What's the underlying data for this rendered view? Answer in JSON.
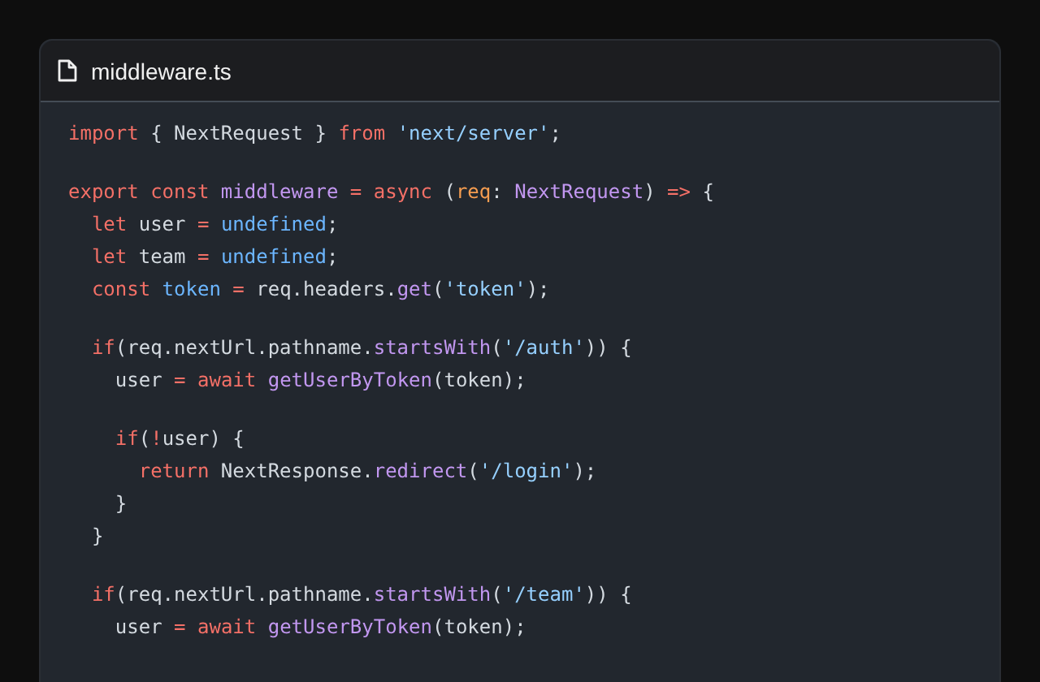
{
  "file_tab": {
    "title": "middleware.ts"
  },
  "code_lines": [
    {
      "kind": "code",
      "tokens": [
        {
          "kind": "keyword",
          "text": "import"
        },
        {
          "kind": "plain",
          "text": " { NextRequest } "
        },
        {
          "kind": "keyword",
          "text": "from"
        },
        {
          "kind": "string",
          "text": " 'next/server'"
        },
        {
          "kind": "plain",
          "text": ";"
        }
      ]
    },
    {
      "kind": "blank"
    },
    {
      "kind": "code",
      "tokens": [
        {
          "kind": "keyword",
          "text": "export const"
        },
        {
          "kind": "function",
          "text": " middleware"
        },
        {
          "kind": "keyword",
          "text": " ="
        },
        {
          "kind": "keyword",
          "text": " async"
        },
        {
          "kind": "plain",
          "text": " ("
        },
        {
          "kind": "param",
          "text": "req"
        },
        {
          "kind": "plain",
          "text": ": "
        },
        {
          "kind": "function",
          "text": "NextRequest"
        },
        {
          "kind": "plain",
          "text": ") "
        },
        {
          "kind": "keyword",
          "text": "=>"
        },
        {
          "kind": "plain",
          "text": " {"
        }
      ]
    },
    {
      "kind": "code",
      "tokens": [
        {
          "kind": "keyword",
          "text": "  let"
        },
        {
          "kind": "plain",
          "text": " user "
        },
        {
          "kind": "keyword",
          "text": "="
        },
        {
          "kind": "constant",
          "text": " undefined"
        },
        {
          "kind": "plain",
          "text": ";"
        }
      ]
    },
    {
      "kind": "code",
      "tokens": [
        {
          "kind": "keyword",
          "text": "  let"
        },
        {
          "kind": "plain",
          "text": " team "
        },
        {
          "kind": "keyword",
          "text": "="
        },
        {
          "kind": "constant",
          "text": " undefined"
        },
        {
          "kind": "plain",
          "text": ";"
        }
      ]
    },
    {
      "kind": "code",
      "tokens": [
        {
          "kind": "keyword",
          "text": "  const"
        },
        {
          "kind": "constant",
          "text": " token"
        },
        {
          "kind": "keyword",
          "text": " ="
        },
        {
          "kind": "plain",
          "text": " req.headers."
        },
        {
          "kind": "function",
          "text": "get"
        },
        {
          "kind": "plain",
          "text": "("
        },
        {
          "kind": "string",
          "text": "'token'"
        },
        {
          "kind": "plain",
          "text": ");"
        }
      ]
    },
    {
      "kind": "blank"
    },
    {
      "kind": "code",
      "tokens": [
        {
          "kind": "keyword",
          "text": "  if"
        },
        {
          "kind": "plain",
          "text": "(req.nextUrl.pathname."
        },
        {
          "kind": "function",
          "text": "startsWith"
        },
        {
          "kind": "plain",
          "text": "("
        },
        {
          "kind": "string",
          "text": "'/auth'"
        },
        {
          "kind": "plain",
          "text": ")) {"
        }
      ]
    },
    {
      "kind": "code",
      "tokens": [
        {
          "kind": "plain",
          "text": "    user "
        },
        {
          "kind": "keyword",
          "text": "="
        },
        {
          "kind": "keyword",
          "text": " await"
        },
        {
          "kind": "function",
          "text": " getUserByToken"
        },
        {
          "kind": "plain",
          "text": "(token);"
        }
      ]
    },
    {
      "kind": "blank"
    },
    {
      "kind": "code",
      "tokens": [
        {
          "kind": "keyword",
          "text": "    if"
        },
        {
          "kind": "plain",
          "text": "("
        },
        {
          "kind": "keyword",
          "text": "!"
        },
        {
          "kind": "plain",
          "text": "user) {"
        }
      ]
    },
    {
      "kind": "code",
      "tokens": [
        {
          "kind": "keyword",
          "text": "      return"
        },
        {
          "kind": "plain",
          "text": " NextResponse."
        },
        {
          "kind": "function",
          "text": "redirect"
        },
        {
          "kind": "plain",
          "text": "("
        },
        {
          "kind": "string",
          "text": "'/login'"
        },
        {
          "kind": "plain",
          "text": ");"
        }
      ]
    },
    {
      "kind": "code",
      "tokens": [
        {
          "kind": "plain",
          "text": "    }"
        }
      ]
    },
    {
      "kind": "code",
      "tokens": [
        {
          "kind": "plain",
          "text": "  }"
        }
      ]
    },
    {
      "kind": "blank"
    },
    {
      "kind": "code",
      "tokens": [
        {
          "kind": "keyword",
          "text": "  if"
        },
        {
          "kind": "plain",
          "text": "(req.nextUrl.pathname."
        },
        {
          "kind": "function",
          "text": "startsWith"
        },
        {
          "kind": "plain",
          "text": "("
        },
        {
          "kind": "string",
          "text": "'/team'"
        },
        {
          "kind": "plain",
          "text": ")) {"
        }
      ]
    },
    {
      "kind": "code",
      "tokens": [
        {
          "kind": "plain",
          "text": "    user "
        },
        {
          "kind": "keyword",
          "text": "="
        },
        {
          "kind": "keyword",
          "text": " await"
        },
        {
          "kind": "function",
          "text": " getUserByToken"
        },
        {
          "kind": "plain",
          "text": "(token);"
        }
      ]
    }
  ]
}
